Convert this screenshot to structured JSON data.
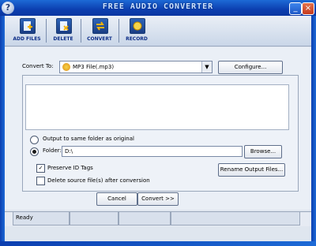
{
  "title_bar": {
    "title": "FREE AUDIO CONVERTER",
    "help_label": "?",
    "minimize_label": "_",
    "close_label": "×"
  },
  "toolbar": {
    "items": [
      {
        "label": "ADD FILES",
        "icon": "add-files-icon"
      },
      {
        "label": "DELETE",
        "icon": "delete-icon"
      },
      {
        "label": "CONVERT",
        "icon": "convert-icon"
      },
      {
        "label": "RECORD",
        "icon": "record-icon"
      }
    ]
  },
  "convert": {
    "label": "Convert To:",
    "selected_format": "MP3 File(.mp3)",
    "configure_label": "Configure..."
  },
  "output": {
    "same_folder_label": "Output to same folder as original",
    "folder_label": "Folder:",
    "folder_value": "D:\\",
    "browse_label": "Browse...",
    "preserve_label": "Preserve ID Tags",
    "delete_label": "Delete source file(s) after conversion",
    "rename_label": "Rename Output Files..."
  },
  "actions": {
    "cancel_label": "Cancel",
    "convert_label": "Convert >>"
  },
  "status": {
    "text": "Ready"
  },
  "colors": {
    "titlebar": "#0c3fb0",
    "accent_blue": "#0d2e87"
  }
}
